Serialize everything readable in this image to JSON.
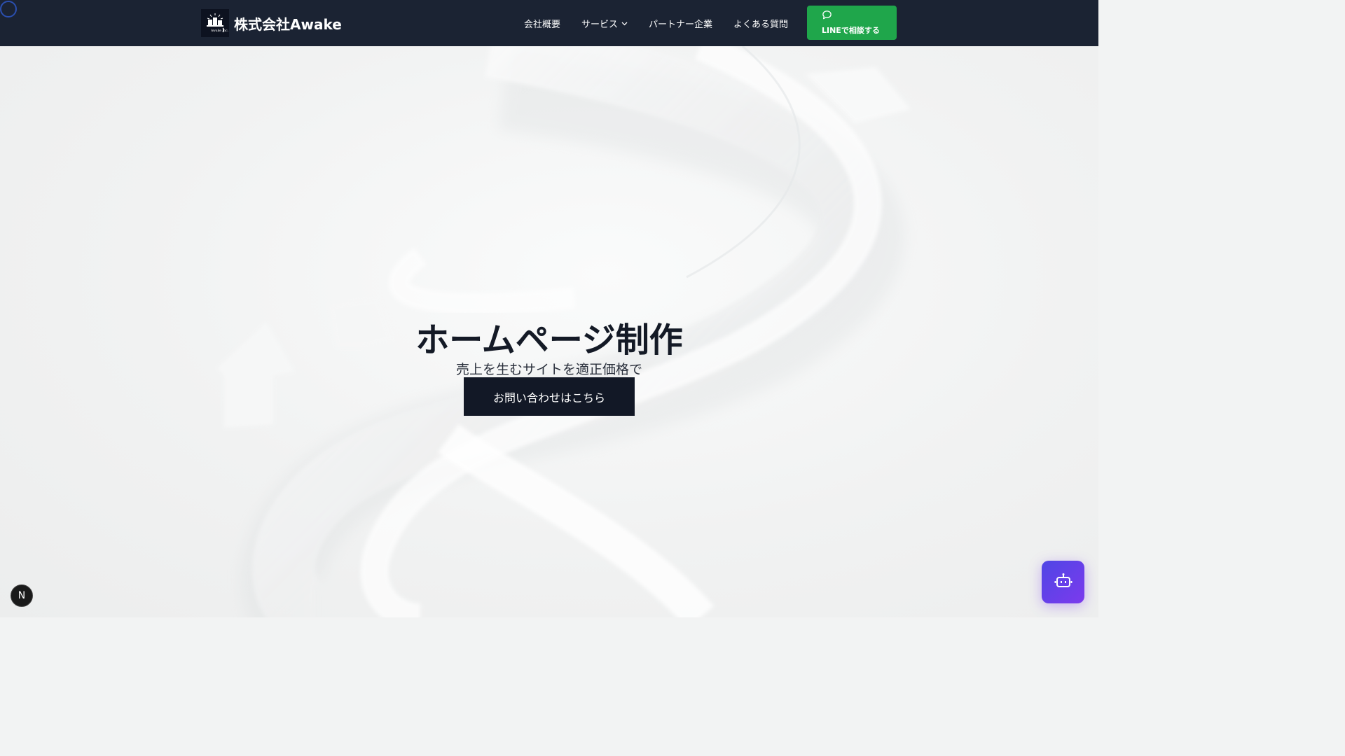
{
  "header": {
    "logo": {
      "mark_text": "Awake Inc.",
      "company_name": "株式会社Awake"
    },
    "nav": [
      {
        "label": "会社概要"
      },
      {
        "label": "サービス",
        "has_dropdown": true
      },
      {
        "label": "パートナー企業"
      },
      {
        "label": "よくある質問"
      }
    ],
    "line_button": {
      "label": "LINEで相談する",
      "icon": "chat-bubble-icon"
    }
  },
  "hero": {
    "title": "ホームページ制作",
    "subtitle": "売上を生むサイトを適正価格で",
    "cta_label": "お問い合わせはこちら"
  },
  "floating": {
    "next_badge": "N",
    "chat_icon": "robot-icon"
  },
  "colors": {
    "header_bg": "#1b2333",
    "line_green": "#1fa64b",
    "cta_bg": "#121826",
    "chat_gradient_start": "#4f46e5",
    "chat_gradient_end": "#7c3aed"
  }
}
